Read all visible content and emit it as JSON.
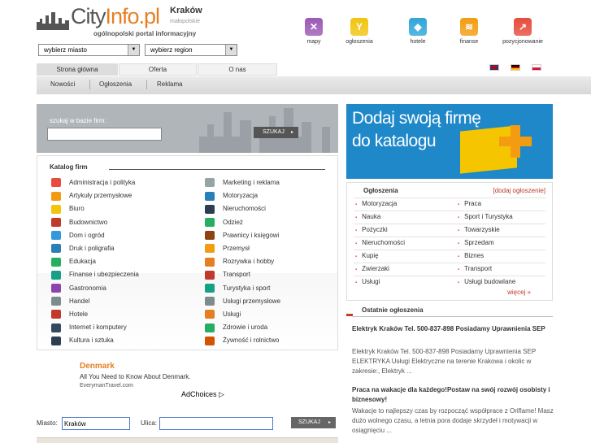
{
  "header": {
    "logo_city": "City",
    "logo_info": "Info.pl",
    "city": "Kraków",
    "region": "małopolskie",
    "tagline": "ogólnopolski portal informacyjny",
    "select_city": "wybierz miasto",
    "select_region": "wybierz region"
  },
  "top_icons": [
    {
      "label": "mapy",
      "color": "#9b59b6",
      "glyph": "✕"
    },
    {
      "label": "ogłoszenia",
      "color": "#f1c40f",
      "glyph": "Y"
    },
    {
      "label": "hotele",
      "color": "#2ea6d8",
      "glyph": "◆"
    },
    {
      "label": "finanse",
      "color": "#f39c12",
      "glyph": "≋"
    },
    {
      "label": "pozycjonowanie",
      "color": "#e74c3c",
      "glyph": "↗"
    }
  ],
  "tabs": [
    "Strona główna",
    "Oferta",
    "O nas"
  ],
  "subnav": [
    "Nowości",
    "Ogłoszenia",
    "Reklama"
  ],
  "search": {
    "label": "szukaj w bazie firm:",
    "button": "SZUKAJ"
  },
  "catalog": {
    "title": "Katalog firm",
    "left": [
      "Administracja i polityka",
      "Artykuły przemysłowe",
      "Biuro",
      "Budownictwo",
      "Dom i ogród",
      "Druk i poligrafia",
      "Edukacja",
      "Finanse i ubezpieczenia",
      "Gastronomia",
      "Handel",
      "Hotele",
      "Internet i komputery",
      "Kultura i sztuka"
    ],
    "right": [
      "Marketing i reklama",
      "Motoryzacja",
      "Nieruchomości",
      "Odzież",
      "Prawnicy i księgowi",
      "Przemysł",
      "Rozrywka i hobby",
      "Transport",
      "Turystyka i sport",
      "Usługi przemysłowe",
      "Usługi",
      "Zdrowie i uroda",
      "Żywność i rolnictwo"
    ]
  },
  "ad": {
    "title": "Denmark",
    "text": "All You Need to Know About Denmark.",
    "url": "EverymanTravel.com",
    "choices": "AdChoices"
  },
  "bottom_search": {
    "city_label": "Miasto:",
    "city_value": "Kraków",
    "street_label": "Ulica:",
    "street_value": "",
    "button": "SZUKAJ"
  },
  "banner": {
    "line1": "Dodaj swoją firmę",
    "line2": "do katalogu"
  },
  "ogloszenia": {
    "title": "Ogłoszenia",
    "add_link": "[dodaj ogłoszenie]",
    "left": [
      "Motoryzacja",
      "Nauka",
      "Pożyczki",
      "Nieruchomości",
      "Kupię",
      "Zwierzaki",
      "Usługi"
    ],
    "right": [
      "Praca",
      "Sport i Turystyka",
      "Towarzyskie",
      "Sprzedam",
      "Biznes",
      "Transport",
      "Usługi budowlane"
    ],
    "more": "więcej »"
  },
  "latest": {
    "title": "Ostatnie ogłoszenia",
    "items": [
      {
        "title": "Elektryk Kraków Tel. 500-837-898 Posiadamy Uprawnienia SEP",
        "body": "Elektryk Kraków Tel. 500-837-898 Posiadamy Uprawnienia SEP ELEKTRYKA Usługi Elektryczne na terenie Krakowa i okolic w zakresie:, Elektryk ..."
      },
      {
        "title": "Praca na wakacje dla każdego!Postaw na swój rozwój osobisty i biznesowy!",
        "body": "Wakacje to najlepszy czas by rozpocząć współprace z Oriflame! Masz dużo wolnego czasu, a letnia pora dodaje skrzydeł i motywacji w osiągnięciu ..."
      }
    ]
  }
}
